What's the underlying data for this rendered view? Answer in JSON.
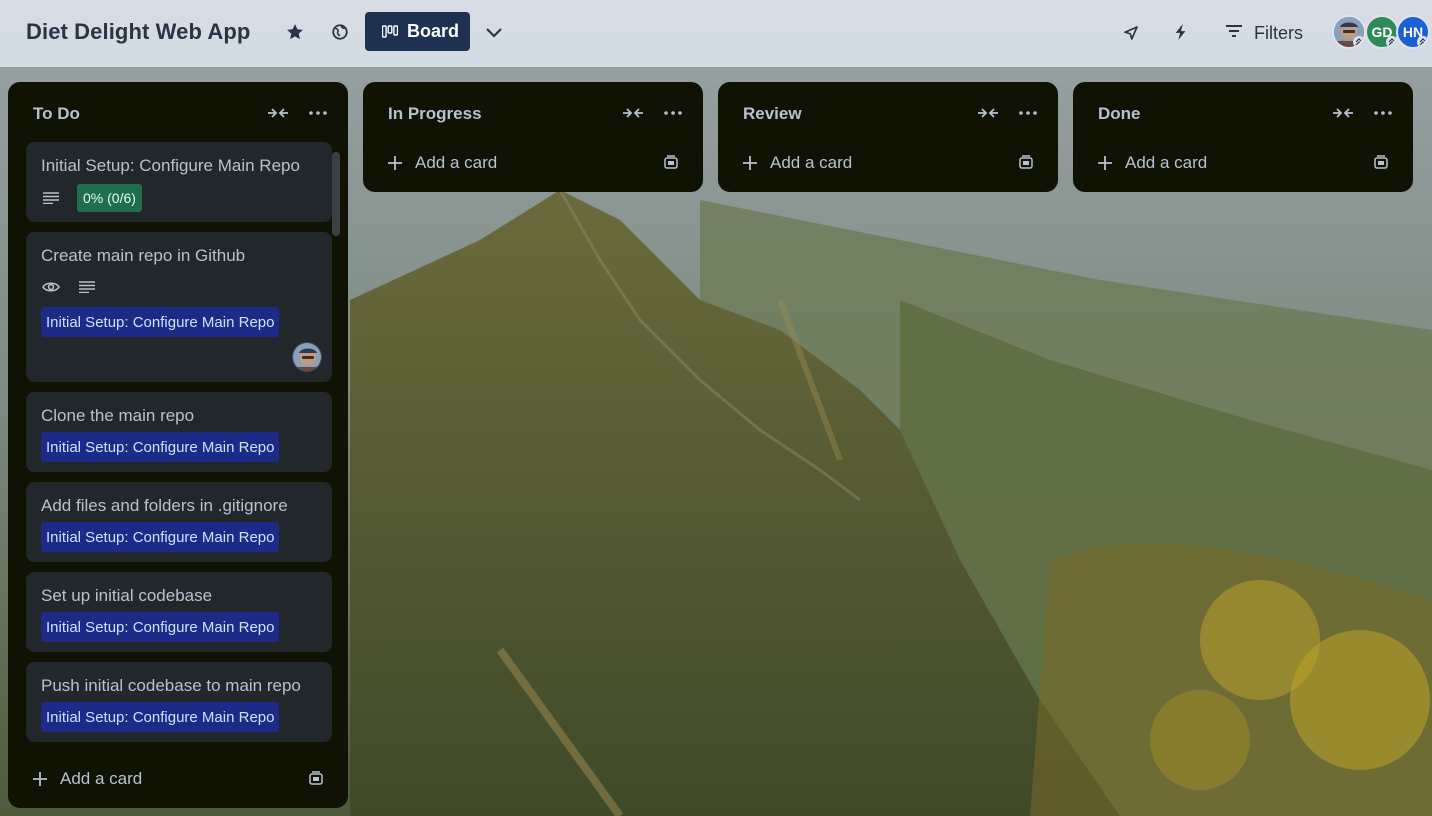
{
  "board": {
    "title": "Diet Delight Web App",
    "view_label": "Board",
    "filters_label": "Filters"
  },
  "header_icons": {
    "star": "star-icon",
    "visibility": "globe-icon",
    "view": "board-icon",
    "view_switch": "chevron-down-icon",
    "power_ups": "rocket-icon",
    "automation": "lightning-icon",
    "filters": "filter-icon"
  },
  "members": [
    {
      "initials": "",
      "kind": "photo"
    },
    {
      "initials": "GD",
      "color": "#2e8b57"
    },
    {
      "initials": "HN",
      "color": "#1f5fd6"
    }
  ],
  "lists": [
    {
      "title": "To Do",
      "add_card_label": "Add a card",
      "cards": [
        {
          "title": "Initial Setup: Configure Main Repo",
          "has_description": true,
          "checklist": "0% (0/6)"
        },
        {
          "title": "Create main repo in Github",
          "watching": true,
          "has_description": true,
          "label": "Initial Setup: Configure Main Repo",
          "member": "photo"
        },
        {
          "title": "Clone the main repo",
          "label": "Initial Setup: Configure Main Repo"
        },
        {
          "title": "Add files and folders in .gitignore",
          "label": "Initial Setup: Configure Main Repo"
        },
        {
          "title": "Set up initial codebase",
          "label": "Initial Setup: Configure Main Repo"
        },
        {
          "title": "Push initial codebase to main repo",
          "label": "Initial Setup: Configure Main Repo"
        }
      ]
    },
    {
      "title": "In Progress",
      "add_card_label": "Add a card"
    },
    {
      "title": "Review",
      "add_card_label": "Add a card"
    },
    {
      "title": "Done",
      "add_card_label": "Add a card"
    }
  ],
  "colors": {
    "list_bg": "#101204",
    "card_bg": "#22272b",
    "label_bg": "#1c2b87",
    "checklist_bg": "#216e4e",
    "view_button_bg": "#1f3150"
  }
}
